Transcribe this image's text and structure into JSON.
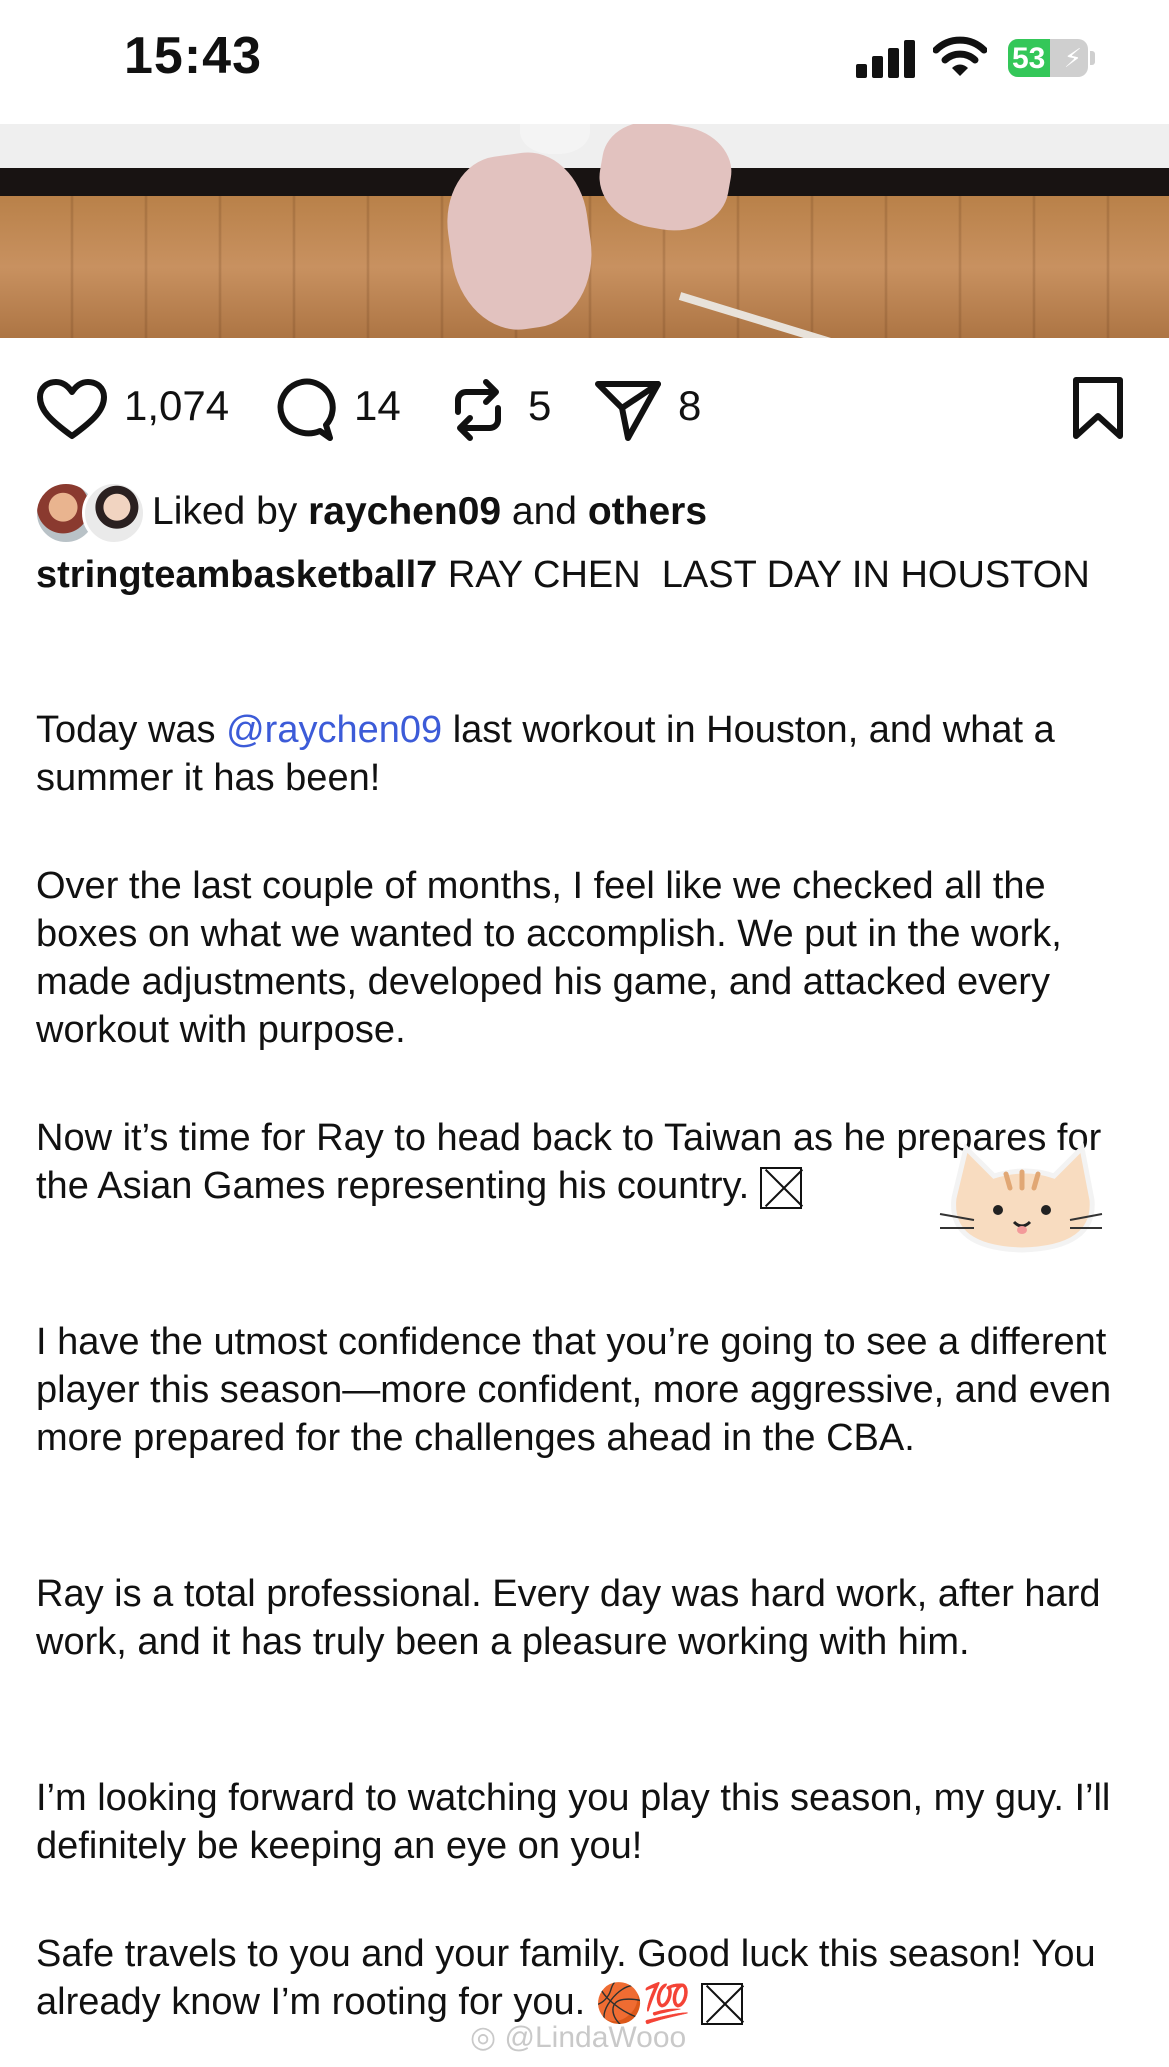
{
  "status_bar": {
    "time": "15:43",
    "battery_percent": "53",
    "battery_level": 0.53,
    "battery_color": "#34c759",
    "icons": [
      "cellular-signal-icon",
      "wifi-icon",
      "battery-charging-icon"
    ]
  },
  "post": {
    "image": "basketball-court-sneakers-photo",
    "actions": {
      "likes": "1,074",
      "comments": "14",
      "reposts": "5",
      "shares": "8"
    },
    "liked_by": {
      "prefix": "Liked by",
      "user": "raychen09",
      "conjunction": "and",
      "others": "others"
    },
    "author": "stringteambasketball7",
    "title_text": "RAY CHEN  LAST DAY IN HOUSTON",
    "mention": "@raychen09",
    "paragraphs": {
      "p1_before": "Today was",
      "p1_after": " last workout in Houston, and what a summer it has been!",
      "p2": "Over the last couple of months, I feel like we checked all the boxes on what we wanted to accomplish. We put in the work, made adjustments, developed his game, and attacked every workout with purpose.",
      "p3": "Now it’s time for Ray to head back to Taiwan as he prepares for the Asian Games representing his country.",
      "p4": "I have the utmost confidence that you’re going to see a different player this season—more confident, more aggressive, and even more prepared for the challenges ahead in the CBA.",
      "p5": "Ray is a total professional. Every day was hard work, after hard work, and it has truly been a pleasure working with him.",
      "p6": "I’m looking forward to watching you play this season, my guy. I’ll definitely be keeping an eye on you!",
      "p7": "Safe travels to you and your family. Good luck this season! You already know I’m rooting for you."
    },
    "emojis": {
      "basketball": "🏀",
      "hundred": "💯"
    },
    "accent_color": "#3c5bd8"
  },
  "watermark": "@LindaWooo"
}
